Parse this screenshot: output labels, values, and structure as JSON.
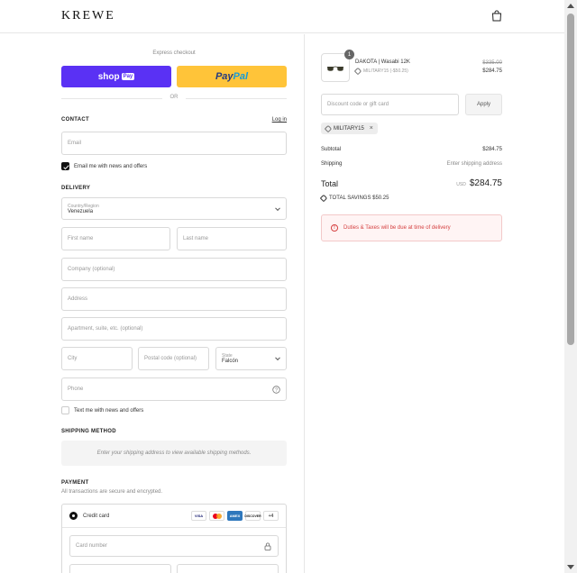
{
  "brand": "KREWE",
  "express": {
    "title": "Express checkout",
    "shop_label": "shop",
    "shop_pay": "Pay",
    "paypal_a": "Pay",
    "paypal_b": "Pal",
    "or": "OR"
  },
  "contact": {
    "title": "CONTACT",
    "login": "Log in",
    "email_placeholder": "Email",
    "news_label": "Email me with news and offers"
  },
  "delivery": {
    "title": "DELIVERY",
    "country_label": "Country/Region",
    "country_value": "Venezuela",
    "first_name": "First name",
    "last_name": "Last name",
    "company": "Company (optional)",
    "address": "Address",
    "apartment": "Apartment, suite, etc. (optional)",
    "city": "City",
    "postal": "Postal code (optional)",
    "state_label": "State",
    "state_value": "Falcón",
    "phone": "Phone",
    "text_label": "Text me with news and offers"
  },
  "shipping": {
    "title": "SHIPPING METHOD",
    "message": "Enter your shipping address to view available shipping methods."
  },
  "payment": {
    "title": "PAYMENT",
    "subtitle": "All transactions are secure and encrypted.",
    "method": "Credit card",
    "cards": [
      "VISA",
      "MC",
      "AMEX",
      "DISCOVER",
      "+4"
    ],
    "card_number": "Card number"
  },
  "order": {
    "item_name": "DAKOTA | Wasabi 12K",
    "item_discount": "MILITARY15 (-$50.25)",
    "item_qty": "1",
    "item_old_price": "$335.00",
    "item_price": "$284.75",
    "discount_placeholder": "Discount code or gift card",
    "apply": "Apply",
    "applied_code": "MILITARY15",
    "subtotal_label": "Subtotal",
    "subtotal": "$284.75",
    "shipping_label": "Shipping",
    "shipping_value": "Enter shipping address",
    "total_label": "Total",
    "currency": "USD",
    "total": "$284.75",
    "savings": "TOTAL SAVINGS $50.25",
    "notice": "Duties & Taxes will be due at time of delivery"
  }
}
